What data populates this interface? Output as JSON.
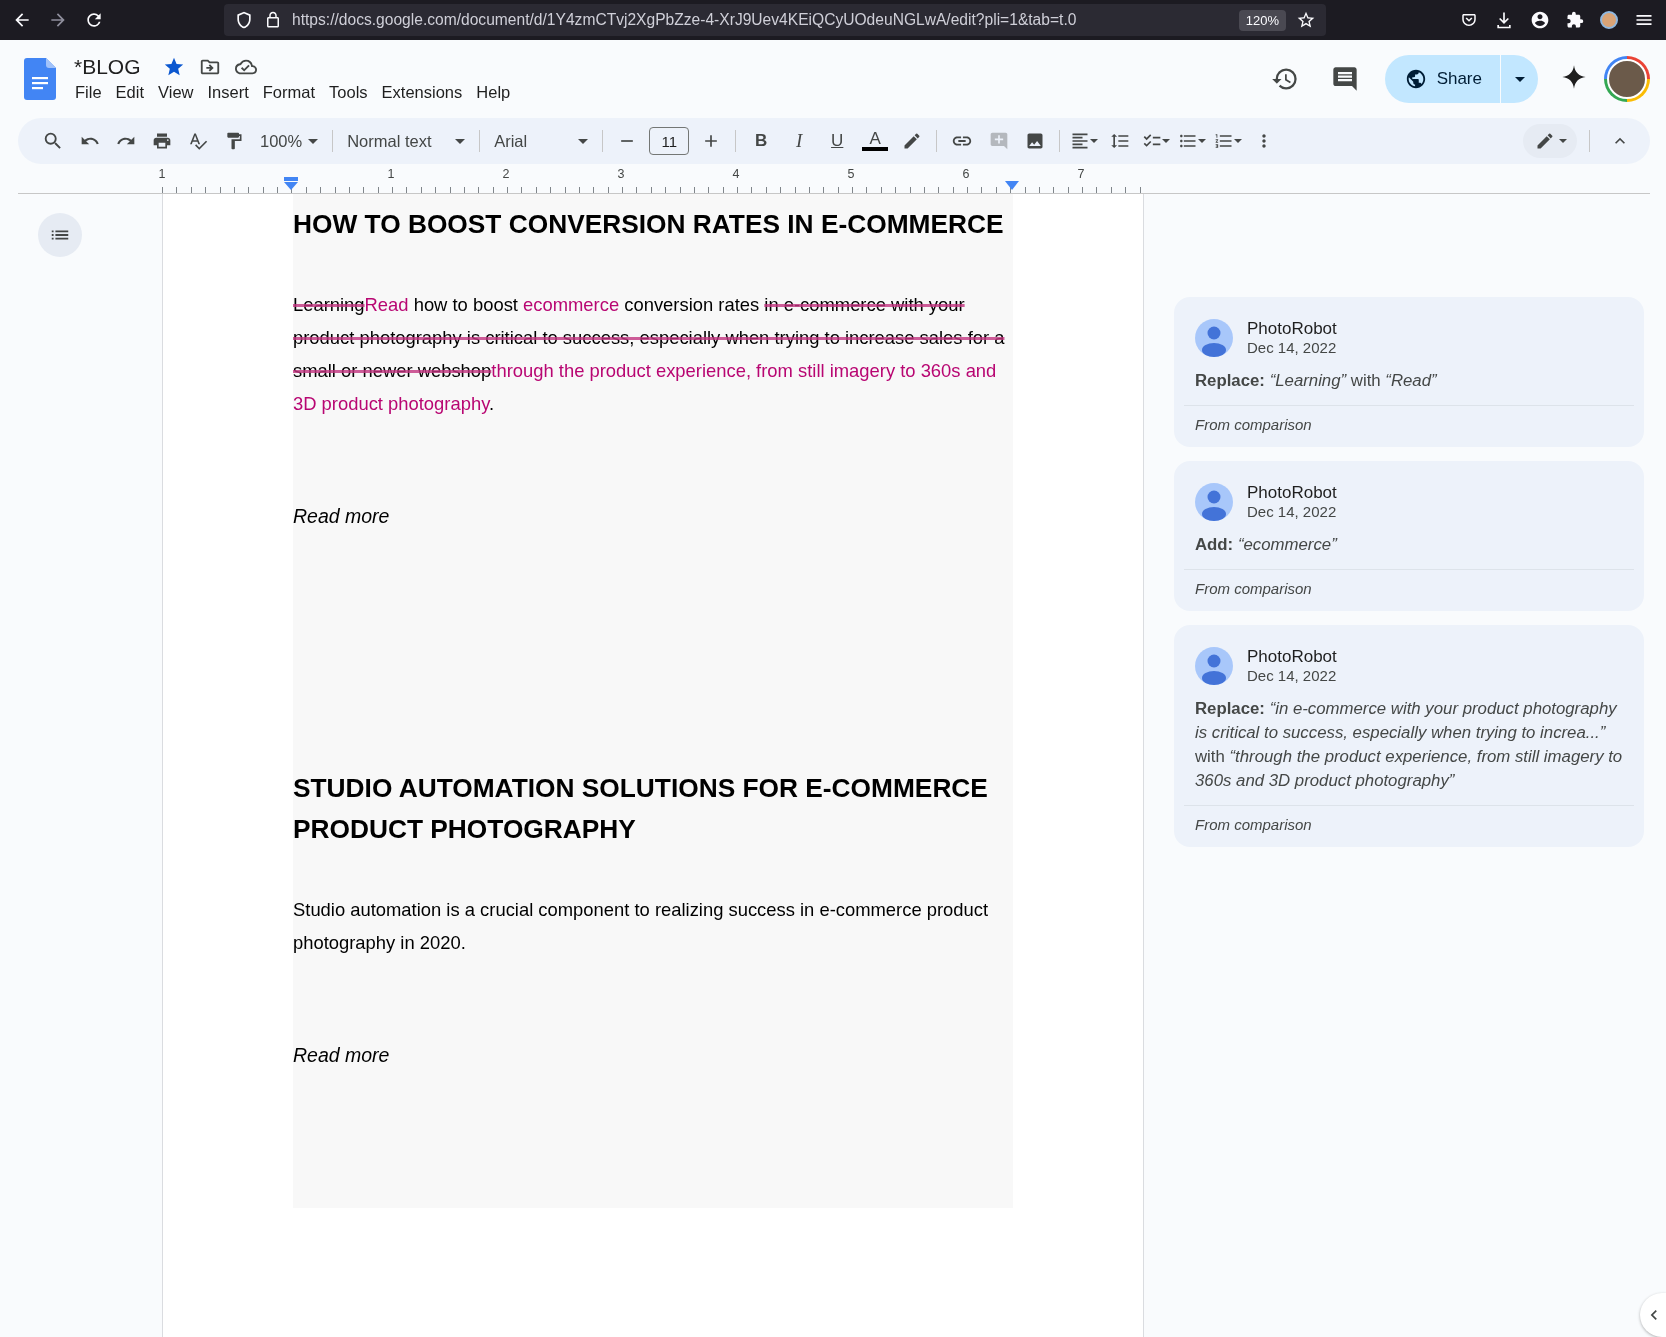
{
  "browser": {
    "url": "https://docs.google.com/document/d/1Y4zmCTvj2XgPbZze-4-XrJ9Uev4KEiQCyUOdeuNGLwA/edit?pli=1&tab=t.0",
    "zoom": "120%"
  },
  "doc": {
    "title": "*BLOG",
    "starred": true,
    "menu": [
      "File",
      "Edit",
      "View",
      "Insert",
      "Format",
      "Tools",
      "Extensions",
      "Help"
    ]
  },
  "share": {
    "label": "Share"
  },
  "toolbar": {
    "zoom": "100%",
    "style": "Normal text",
    "font": "Arial",
    "font_size": "11",
    "format_buttons": [
      "B",
      "I",
      "U",
      "A"
    ]
  },
  "ruler": [
    "1",
    "1",
    "2",
    "3",
    "4",
    "5",
    "6",
    "7"
  ],
  "blocks": [
    {
      "kind": "heading",
      "text": "HOW TO BOOST CONVERSION RATES IN E-COMMERCE"
    },
    {
      "kind": "paragraph",
      "runs": [
        {
          "text": "Learning",
          "kind": "deleted"
        },
        {
          "text": "Read",
          "kind": "inserted"
        },
        {
          "text": " how to boost ",
          "kind": "normal"
        },
        {
          "text": "ecommerce",
          "kind": "inserted"
        },
        {
          "text": " conversion rates ",
          "kind": "normal"
        },
        {
          "text": "in e-commerce with your product photography is critical to success, especially when trying to increase sales for a small or newer webshop",
          "kind": "deleted"
        },
        {
          "text": "through the product experience,  from still imagery to 360s and 3D product photography",
          "kind": "inserted"
        },
        {
          "text": ".",
          "kind": "normal"
        }
      ]
    },
    {
      "kind": "italic",
      "text": "Read more"
    },
    {
      "kind": "heading",
      "text": "STUDIO AUTOMATION SOLUTIONS FOR E-COMMERCE PRODUCT PHOTOGRAPHY"
    },
    {
      "kind": "paragraph",
      "runs": [
        {
          "text": "Studio automation is a crucial component to realizing success in e-commerce product photography in 2020.",
          "kind": "normal"
        }
      ]
    },
    {
      "kind": "italic",
      "text": "Read more"
    }
  ],
  "comments": [
    {
      "author": "PhotoRobot",
      "date": "Dec 14, 2022",
      "body": "**Replace:** *“Learning”* with *“Read”*",
      "footer": "From comparison"
    },
    {
      "author": "PhotoRobot",
      "date": "Dec 14, 2022",
      "body": "**Add:** *“ecommerce”*",
      "footer": "From comparison"
    },
    {
      "author": "PhotoRobot",
      "date": "Dec 14, 2022",
      "body": "**Replace:** *“in e-commerce with your product photography is critical to success, especially when trying to increa...”* with *“through the product experience, from still imagery to 360s and 3D product photography”*",
      "footer": "From comparison"
    }
  ]
}
